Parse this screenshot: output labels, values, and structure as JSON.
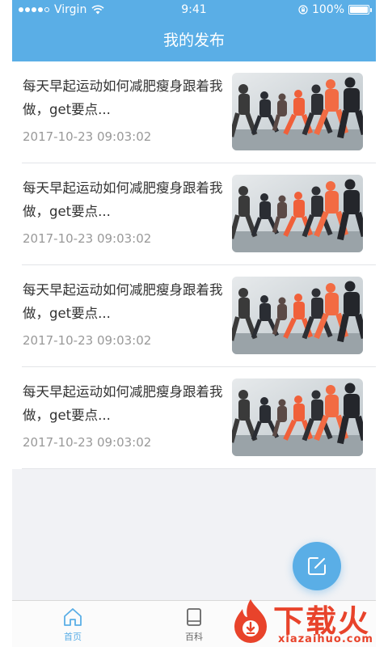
{
  "status_bar": {
    "carrier": "Virgin",
    "time": "9:41",
    "battery": "100%"
  },
  "nav": {
    "title": "我的发布"
  },
  "posts": [
    {
      "title": "每天早起运动如何减肥瘦身跟着我做，get要点...",
      "date": "2017-10-23  09:03:02",
      "image": "runners-photo"
    },
    {
      "title": "每天早起运动如何减肥瘦身跟着我做，get要点...",
      "date": "2017-10-23  09:03:02",
      "image": "runners-photo"
    },
    {
      "title": "每天早起运动如何减肥瘦身跟着我做，get要点...",
      "date": "2017-10-23  09:03:02",
      "image": "runners-photo"
    },
    {
      "title": "每天早起运动如何减肥瘦身跟着我做，get要点...",
      "date": "2017-10-23  09:03:02",
      "image": "runners-photo"
    }
  ],
  "fab": {
    "icon": "edit-icon"
  },
  "tabs": [
    {
      "label": "首页",
      "icon": "home-icon",
      "active": true
    },
    {
      "label": "百科",
      "icon": "book-icon",
      "active": false
    }
  ],
  "watermark": {
    "brand": "下载火",
    "domain": "xiazaihuo.com"
  },
  "colors": {
    "primary": "#5aaee6",
    "watermark": "#e8432b",
    "text": "#333333",
    "muted": "#999999",
    "background": "#f1f2f5"
  }
}
